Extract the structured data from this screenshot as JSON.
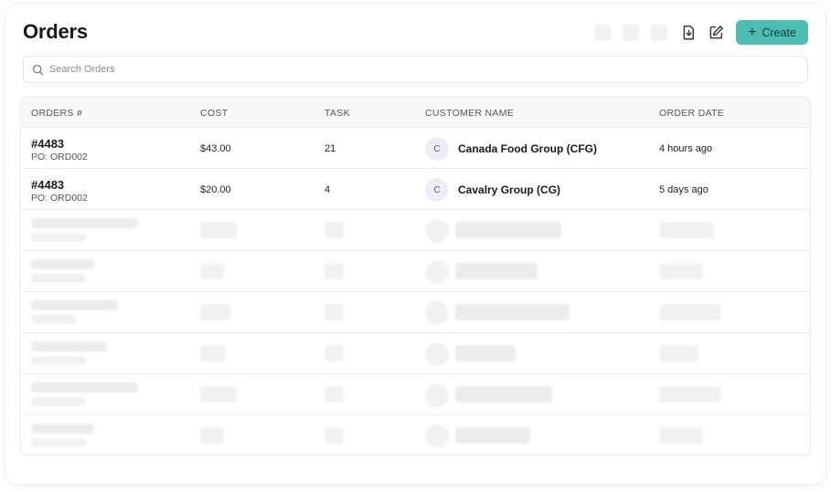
{
  "page": {
    "title": "Orders"
  },
  "toolbar": {
    "icons": [
      "download-icon",
      "edit-icon"
    ],
    "create_label": "Create",
    "accent": "#4cbdb2"
  },
  "search": {
    "placeholder": "Search Orders"
  },
  "table": {
    "columns": [
      "ORDERS #",
      "COST",
      "TASK",
      "CUSTOMER NAME",
      "ORDER DATE"
    ],
    "rows": [
      {
        "order": "#4483",
        "po": "PO: ORD002",
        "cost": "$43.00",
        "task": "21",
        "avatar": "C",
        "customer": "Canada Food Group (CFG)",
        "date": "4 hours ago"
      },
      {
        "order": "#4483",
        "po": "PO: ORD002",
        "cost": "$20.00",
        "task": "4",
        "avatar": "C",
        "customer": "Cavalry Group (CG)",
        "date": "5 days ago"
      }
    ],
    "loading_rows": 6
  }
}
